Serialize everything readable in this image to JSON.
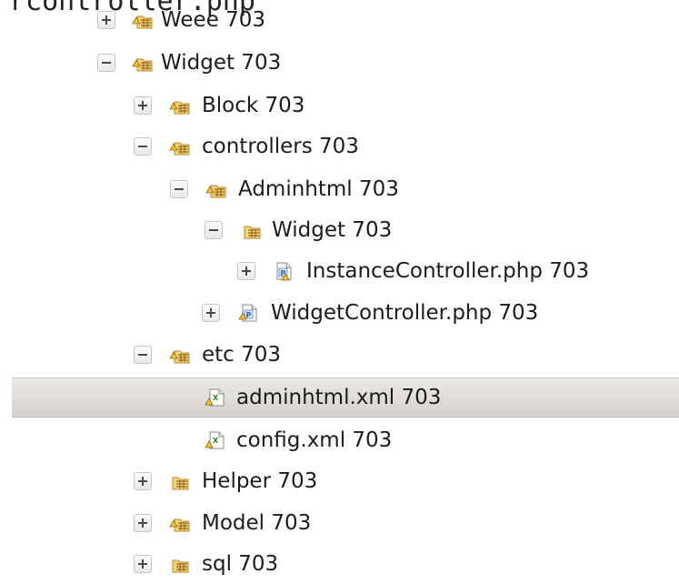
{
  "top_text": "rcontroller.php",
  "tree": {
    "items": [
      {
        "label": "Weee 703",
        "state": "collapsed",
        "icon": "package-folder-icon"
      },
      {
        "label": "Widget 703",
        "state": "expanded",
        "icon": "package-folder-icon"
      },
      {
        "label": "Block 703",
        "state": "collapsed",
        "icon": "package-folder-icon"
      },
      {
        "label": "controllers 703",
        "state": "expanded",
        "icon": "package-folder-icon"
      },
      {
        "label": "Adminhtml 703",
        "state": "expanded",
        "icon": "package-folder-icon"
      },
      {
        "label": "Widget 703",
        "state": "expanded",
        "icon": "package-folder-icon"
      },
      {
        "label": "InstanceController.php 703",
        "state": "collapsed",
        "icon": "php-file-icon"
      },
      {
        "label": "WidgetController.php 703",
        "state": "collapsed",
        "icon": "php-file-icon"
      },
      {
        "label": "etc 703",
        "state": "expanded",
        "icon": "package-folder-icon"
      },
      {
        "label": "adminhtml.xml 703",
        "state": "leaf",
        "icon": "xml-file-icon",
        "selected": true
      },
      {
        "label": "config.xml 703",
        "state": "leaf",
        "icon": "xml-file-icon"
      },
      {
        "label": "Helper 703",
        "state": "collapsed",
        "icon": "package-folder-icon"
      },
      {
        "label": "Model 703",
        "state": "collapsed",
        "icon": "package-folder-icon"
      },
      {
        "label": "sql 703",
        "state": "collapsed",
        "icon": "package-folder-icon"
      }
    ]
  },
  "colors": {
    "selection_top": "#ebe9e6",
    "selection_bottom": "#d6d2cd",
    "folder_fill": "#f4d47a",
    "folder_stroke": "#b8892a",
    "warning_yellow": "#f2c12e"
  }
}
